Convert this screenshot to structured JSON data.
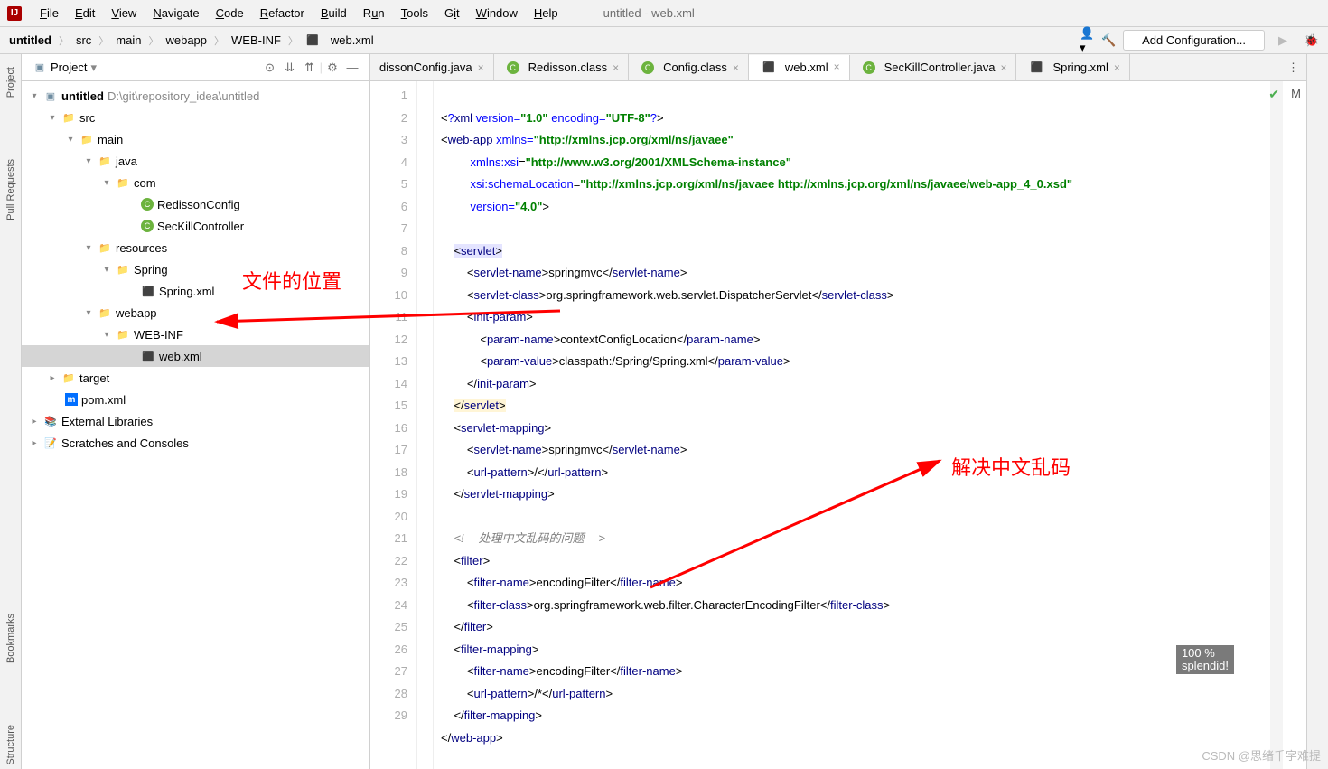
{
  "window_title": "untitled - web.xml",
  "menu": [
    "File",
    "Edit",
    "View",
    "Navigate",
    "Code",
    "Refactor",
    "Build",
    "Run",
    "Tools",
    "Git",
    "Window",
    "Help"
  ],
  "breadcrumbs": [
    "untitled",
    "src",
    "main",
    "webapp",
    "WEB-INF",
    "web.xml"
  ],
  "config_button": "Add Configuration...",
  "project_panel_title": "Project",
  "tree": {
    "root": {
      "label": "untitled",
      "path": "D:\\git\\repository_idea\\untitled"
    },
    "src": "src",
    "main": "main",
    "java": "java",
    "com": "com",
    "redisson_config": "RedissonConfig",
    "seckill": "SecKillController",
    "resources": "resources",
    "spring_folder": "Spring",
    "spring_xml": "Spring.xml",
    "webapp": "webapp",
    "webinf": "WEB-INF",
    "web_xml": "web.xml",
    "target": "target",
    "pom": "pom.xml",
    "ext_lib": "External Libraries",
    "scratches": "Scratches and Consoles"
  },
  "tabs": [
    {
      "label": "dissonConfig.java",
      "icon": "c",
      "close": true,
      "truncated": true
    },
    {
      "label": "Redisson.class",
      "icon": "c",
      "close": true
    },
    {
      "label": "Config.class",
      "icon": "c",
      "close": true
    },
    {
      "label": "web.xml",
      "icon": "xml",
      "close": true,
      "active": true
    },
    {
      "label": "SecKillController.java",
      "icon": "c",
      "close": true
    },
    {
      "label": "Spring.xml",
      "icon": "xml",
      "close": true
    }
  ],
  "line_numbers": [
    1,
    2,
    3,
    4,
    5,
    6,
    7,
    8,
    9,
    10,
    11,
    12,
    13,
    14,
    15,
    16,
    17,
    18,
    19,
    20,
    21,
    22,
    23,
    24,
    25,
    26,
    27,
    28,
    29
  ],
  "code": {
    "xml_decl_q": "?",
    "xml_decl": "xml",
    "version_attr": "version=",
    "version_val": "\"1.0\"",
    "encoding_attr": "encoding=",
    "encoding_val": "\"UTF-8\"",
    "webapp": "web-app",
    "xmlns_attr": "xmlns=",
    "xmlns_val": "\"http://xmlns.jcp.org/xml/ns/javaee\"",
    "xmlns_xsi": "xmlns:xsi",
    "xsi_val": "\"http://www.w3.org/2001/XMLSchema-instance\"",
    "schema_loc": "xsi:schemaLocation",
    "schema_val": "\"http://xmlns.jcp.org/xml/ns/javaee http://xmlns.jcp.org/xml/ns/javaee/web-app_4_0.xsd\"",
    "version4_attr": "version=",
    "version4_val": "\"4.0\"",
    "servlet": "servlet",
    "servlet_name": "servlet-name",
    "springmvc": "springmvc",
    "servlet_class": "servlet-class",
    "dispatcher": "org.springframework.web.servlet.DispatcherServlet",
    "init_param": "init-param",
    "param_name": "param-name",
    "context_config": "contextConfigLocation",
    "param_value": "param-value",
    "classpath": "classpath:/Spring/Spring.xml",
    "servlet_mapping": "servlet-mapping",
    "url_pattern": "url-pattern",
    "slash": "/",
    "comment": "<!--  处理中文乱码的问题  -->",
    "filter": "filter",
    "filter_name": "filter-name",
    "encoding_filter": "encodingFilter",
    "filter_class": "filter-class",
    "char_filter": "org.springframework.web.filter.CharacterEncodingFilter",
    "filter_mapping": "filter-mapping",
    "slash_star": "/*"
  },
  "annotations": {
    "file_location": "文件的位置",
    "solve_garbled": "解决中文乱码"
  },
  "splendid": {
    "line1": "100 %",
    "line2": "splendid!"
  },
  "watermark": "CSDN @思绪千字难提",
  "left_tabs": {
    "project": "Project",
    "pull": "Pull Requests",
    "bookmarks": "Bookmarks",
    "structure": "Structure"
  }
}
